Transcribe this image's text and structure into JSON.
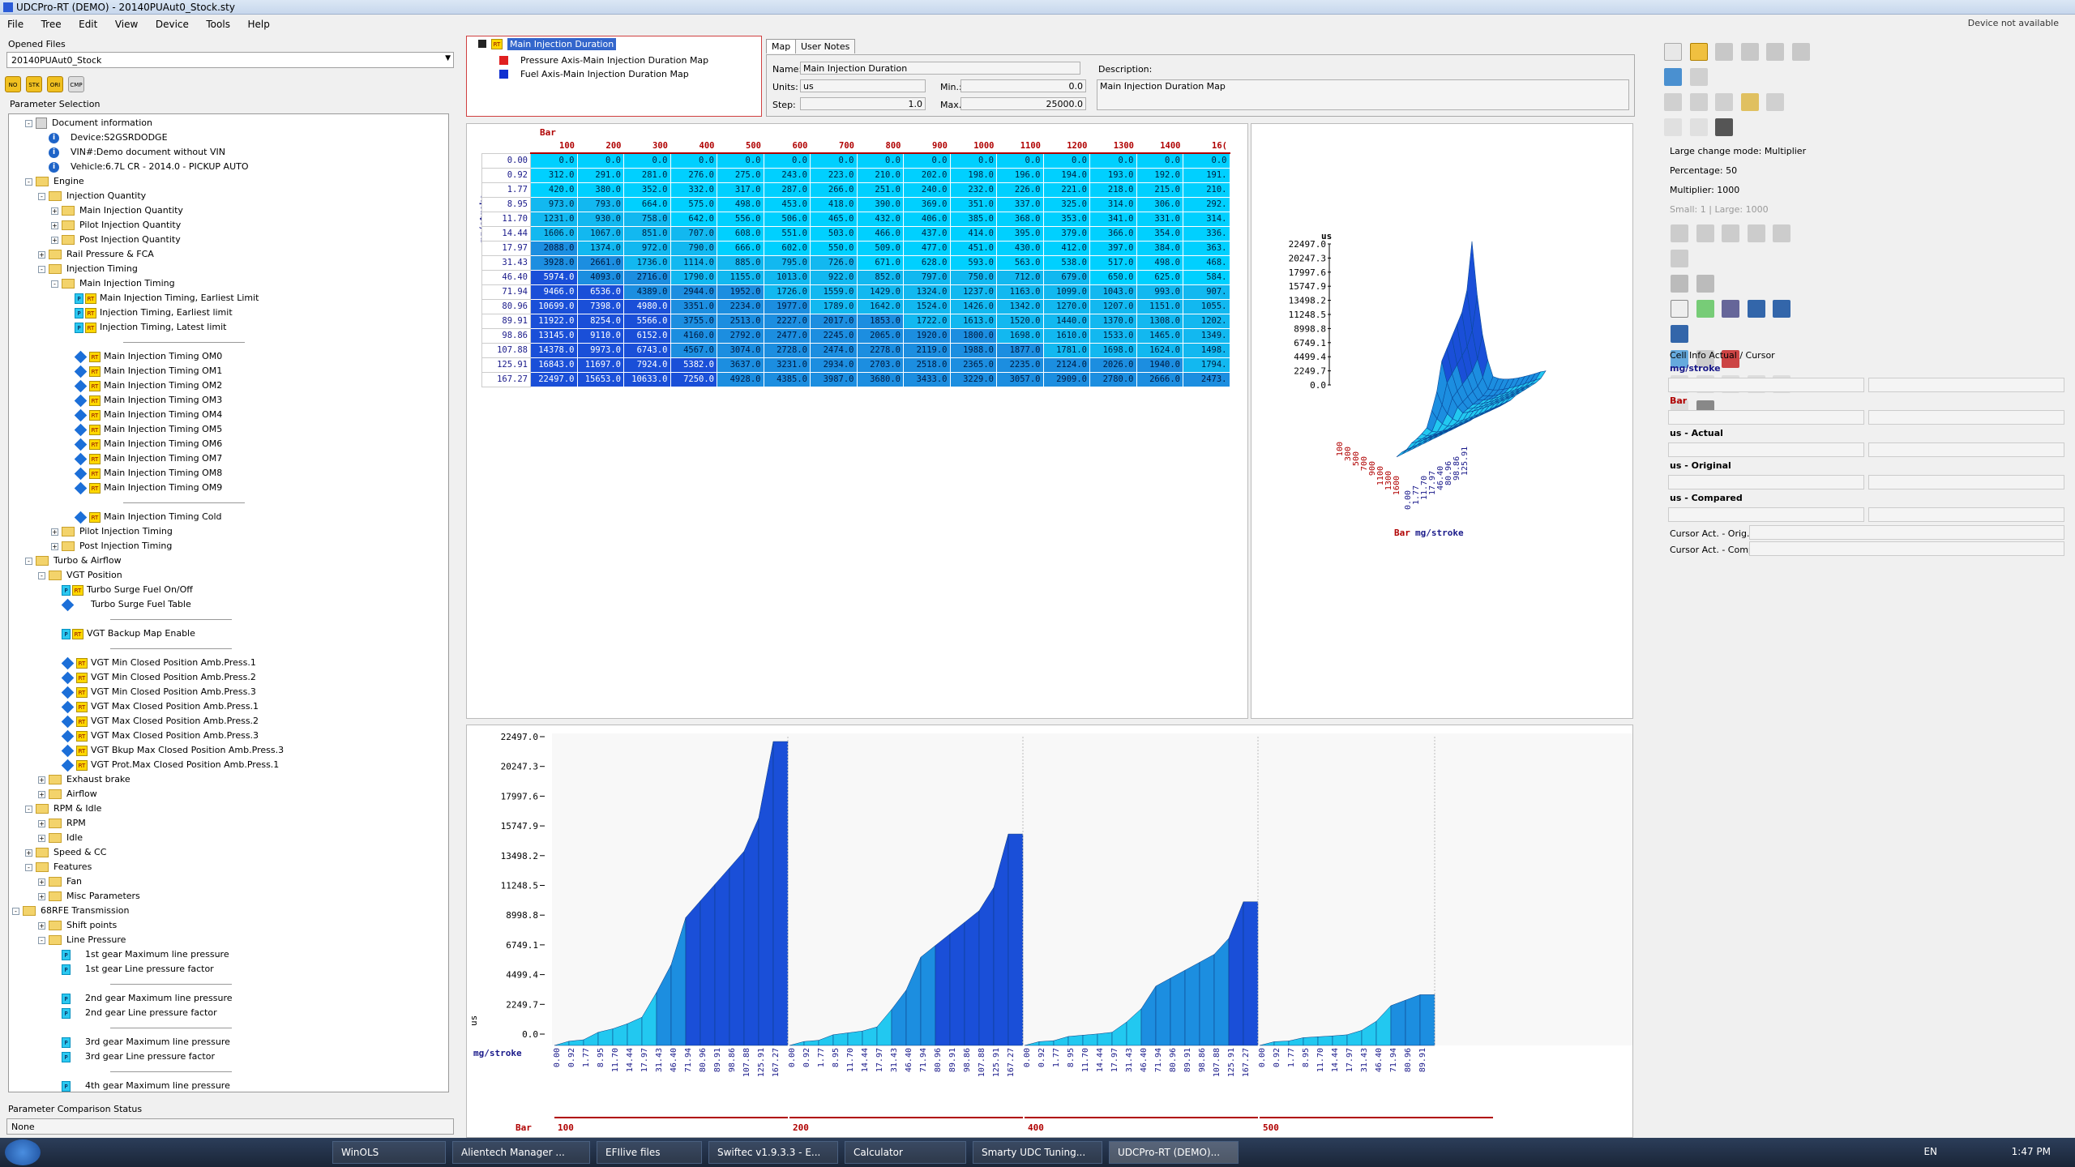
{
  "window": {
    "title": "UDCPro-RT (DEMO) - 20140PUAut0_Stock.sty",
    "device_status": "Device not available"
  },
  "menu": [
    "File",
    "Tree",
    "Edit",
    "View",
    "Device",
    "Tools",
    "Help"
  ],
  "left": {
    "opened_files_label": "Opened Files",
    "opened_file": "20140PUAut0_Stock",
    "toolbar_buttons": [
      "NO",
      "STK",
      "ORI",
      "CMP"
    ],
    "parameter_selection_label": "Parameter Selection",
    "comparison_label": "Parameter Comparison Status",
    "comparison_value": "None"
  },
  "tree": [
    {
      "d": 0,
      "icon": "doc",
      "tog": "-",
      "text": "Document information"
    },
    {
      "d": 1,
      "icon": "info",
      "text": "Device:S2GSRDODGE"
    },
    {
      "d": 1,
      "icon": "info",
      "text": "VIN#:Demo document without VIN"
    },
    {
      "d": 1,
      "icon": "info",
      "text": "Vehicle:6.7L CR - 2014.0 - PICKUP AUTO"
    },
    {
      "d": 0,
      "icon": "folder",
      "tog": "-",
      "text": "Engine"
    },
    {
      "d": 1,
      "icon": "folder",
      "tog": "-",
      "text": "Injection Quantity"
    },
    {
      "d": 2,
      "icon": "folder",
      "tog": "+",
      "text": "Main Injection Quantity"
    },
    {
      "d": 2,
      "icon": "folder",
      "tog": "+",
      "text": "Pilot Injection Quantity"
    },
    {
      "d": 2,
      "icon": "folder",
      "tog": "+",
      "text": "Post Injection Quantity"
    },
    {
      "d": 1,
      "icon": "folder",
      "tog": "+",
      "text": "Rail Pressure & FCA"
    },
    {
      "d": 1,
      "icon": "folder",
      "tog": "-",
      "text": "Injection Timing"
    },
    {
      "d": 2,
      "icon": "folder",
      "tog": "-",
      "text": "Main Injection Timing"
    },
    {
      "d": 3,
      "icon": "prt",
      "text": "Main Injection Timing, Earliest Limit"
    },
    {
      "d": 3,
      "icon": "prt",
      "text": "Injection Timing, Earliest limit"
    },
    {
      "d": 3,
      "icon": "prt",
      "text": "Injection Timing, Latest limit"
    },
    {
      "d": 3,
      "icon": "sep",
      "text": ""
    },
    {
      "d": 3,
      "icon": "drt",
      "text": "Main Injection Timing OM0"
    },
    {
      "d": 3,
      "icon": "drt",
      "text": "Main Injection Timing OM1"
    },
    {
      "d": 3,
      "icon": "drt",
      "text": "Main Injection Timing OM2"
    },
    {
      "d": 3,
      "icon": "drt",
      "text": "Main Injection Timing OM3"
    },
    {
      "d": 3,
      "icon": "drt",
      "text": "Main Injection Timing OM4"
    },
    {
      "d": 3,
      "icon": "drt",
      "text": "Main Injection Timing OM5"
    },
    {
      "d": 3,
      "icon": "drt",
      "text": "Main Injection Timing OM6"
    },
    {
      "d": 3,
      "icon": "drt",
      "text": "Main Injection Timing OM7"
    },
    {
      "d": 3,
      "icon": "drt",
      "text": "Main Injection Timing OM8"
    },
    {
      "d": 3,
      "icon": "drt",
      "text": "Main Injection Timing OM9"
    },
    {
      "d": 3,
      "icon": "sep",
      "text": ""
    },
    {
      "d": 3,
      "icon": "drt",
      "text": "Main Injection Timing Cold"
    },
    {
      "d": 2,
      "icon": "folder",
      "tog": "+",
      "text": "Pilot Injection Timing"
    },
    {
      "d": 2,
      "icon": "folder",
      "tog": "+",
      "text": "Post Injection Timing"
    },
    {
      "d": 0,
      "icon": "folder",
      "tog": "-",
      "text": "Turbo & Airflow",
      "indent": 1
    },
    {
      "d": 1,
      "icon": "folder",
      "tog": "-",
      "text": "VGT Position"
    },
    {
      "d": 2,
      "icon": "prt",
      "text": "Turbo Surge Fuel On/Off"
    },
    {
      "d": 2,
      "icon": "d",
      "text": "Turbo Surge Fuel Table"
    },
    {
      "d": 2,
      "icon": "sep",
      "text": ""
    },
    {
      "d": 2,
      "icon": "prt",
      "text": "VGT Backup Map Enable"
    },
    {
      "d": 2,
      "icon": "sep",
      "text": ""
    },
    {
      "d": 2,
      "icon": "drt",
      "text": "VGT Min Closed Position Amb.Press.1"
    },
    {
      "d": 2,
      "icon": "drt",
      "text": "VGT Min Closed Position Amb.Press.2"
    },
    {
      "d": 2,
      "icon": "drt",
      "text": "VGT Min Closed Position Amb.Press.3"
    },
    {
      "d": 2,
      "icon": "drt",
      "text": "VGT Max Closed Position Amb.Press.1"
    },
    {
      "d": 2,
      "icon": "drt",
      "text": "VGT Max Closed Position Amb.Press.2"
    },
    {
      "d": 2,
      "icon": "drt",
      "text": "VGT Max Closed Position Amb.Press.3"
    },
    {
      "d": 2,
      "icon": "drt",
      "text": "VGT Bkup Max Closed Position Amb.Press.3"
    },
    {
      "d": 2,
      "icon": "drt",
      "text": "VGT Prot.Max Closed Position Amb.Press.1"
    },
    {
      "d": 1,
      "icon": "folder",
      "tog": "+",
      "text": "Exhaust brake"
    },
    {
      "d": 1,
      "icon": "folder",
      "tog": "+",
      "text": "Airflow"
    },
    {
      "d": 0,
      "icon": "folder",
      "tog": "-",
      "text": "RPM & Idle",
      "indent": 1
    },
    {
      "d": 1,
      "icon": "folder",
      "tog": "+",
      "text": "RPM"
    },
    {
      "d": 1,
      "icon": "folder",
      "tog": "+",
      "text": "Idle"
    },
    {
      "d": 0,
      "icon": "folder",
      "tog": "+",
      "text": "Speed & CC",
      "indent": 1
    },
    {
      "d": 0,
      "icon": "folder",
      "tog": "-",
      "text": "Features",
      "indent": 1
    },
    {
      "d": 1,
      "icon": "folder",
      "tog": "+",
      "text": "Fan"
    },
    {
      "d": 1,
      "icon": "folder",
      "tog": "+",
      "text": "Misc Parameters"
    },
    {
      "d": 0,
      "icon": "folder",
      "tog": "-",
      "text": "68RFE Transmission",
      "root": 1
    },
    {
      "d": 1,
      "icon": "folder",
      "tog": "+",
      "text": "Shift points"
    },
    {
      "d": 1,
      "icon": "folder",
      "tog": "-",
      "text": "Line Pressure"
    },
    {
      "d": 2,
      "icon": "p",
      "text": "1st gear Maximum line pressure"
    },
    {
      "d": 2,
      "icon": "p",
      "text": "1st gear Line pressure factor"
    },
    {
      "d": 2,
      "icon": "sep",
      "text": ""
    },
    {
      "d": 2,
      "icon": "p",
      "text": "2nd gear Maximum line pressure"
    },
    {
      "d": 2,
      "icon": "p",
      "text": "2nd gear Line pressure factor"
    },
    {
      "d": 2,
      "icon": "sep",
      "text": ""
    },
    {
      "d": 2,
      "icon": "p",
      "text": "3rd gear Maximum line pressure"
    },
    {
      "d": 2,
      "icon": "p",
      "text": "3rd gear Line pressure factor"
    },
    {
      "d": 2,
      "icon": "sep",
      "text": ""
    },
    {
      "d": 2,
      "icon": "p",
      "text": "4th gear Maximum line pressure"
    }
  ],
  "maplist": {
    "selected": "Main Injection Duration",
    "items": [
      "Pressure Axis-Main Injection Duration Map",
      "Fuel Axis-Main Injection Duration Map"
    ],
    "colors": [
      "#e02020",
      "#1030d0"
    ]
  },
  "props": {
    "tab_map": "Map",
    "tab_notes": "User Notes",
    "name_label": "Name:",
    "name": "Main Injection Duration",
    "units_label": "Units:",
    "units": "us",
    "step_label": "Step:",
    "step": "1.0",
    "min_label": "Min.:",
    "min": "0.0",
    "max_label": "Max.:",
    "max": "25000.0",
    "desc_label": "Description:",
    "desc": "Main Injection Duration Map"
  },
  "table": {
    "col_axis_label": "Bar",
    "row_axis_label": "mg/stroke",
    "cols": [
      "100",
      "200",
      "300",
      "400",
      "500",
      "600",
      "700",
      "800",
      "900",
      "1000",
      "1100",
      "1200",
      "1300",
      "1400",
      "16("
    ],
    "rows": [
      "0.00",
      "0.92",
      "1.77",
      "8.95",
      "11.70",
      "14.44",
      "17.97",
      "31.43",
      "46.40",
      "71.94",
      "80.96",
      "89.91",
      "98.86",
      "107.88",
      "125.91",
      "167.27"
    ],
    "cells": [
      [
        "0.0",
        "0.0",
        "0.0",
        "0.0",
        "0.0",
        "0.0",
        "0.0",
        "0.0",
        "0.0",
        "0.0",
        "0.0",
        "0.0",
        "0.0",
        "0.0",
        "0.0"
      ],
      [
        "312.0",
        "291.0",
        "281.0",
        "276.0",
        "275.0",
        "243.0",
        "223.0",
        "210.0",
        "202.0",
        "198.0",
        "196.0",
        "194.0",
        "193.0",
        "192.0",
        "191."
      ],
      [
        "420.0",
        "380.0",
        "352.0",
        "332.0",
        "317.0",
        "287.0",
        "266.0",
        "251.0",
        "240.0",
        "232.0",
        "226.0",
        "221.0",
        "218.0",
        "215.0",
        "210."
      ],
      [
        "973.0",
        "793.0",
        "664.0",
        "575.0",
        "498.0",
        "453.0",
        "418.0",
        "390.0",
        "369.0",
        "351.0",
        "337.0",
        "325.0",
        "314.0",
        "306.0",
        "292."
      ],
      [
        "1231.0",
        "930.0",
        "758.0",
        "642.0",
        "556.0",
        "506.0",
        "465.0",
        "432.0",
        "406.0",
        "385.0",
        "368.0",
        "353.0",
        "341.0",
        "331.0",
        "314."
      ],
      [
        "1606.0",
        "1067.0",
        "851.0",
        "707.0",
        "608.0",
        "551.0",
        "503.0",
        "466.0",
        "437.0",
        "414.0",
        "395.0",
        "379.0",
        "366.0",
        "354.0",
        "336."
      ],
      [
        "2088.0",
        "1374.0",
        "972.0",
        "790.0",
        "666.0",
        "602.0",
        "550.0",
        "509.0",
        "477.0",
        "451.0",
        "430.0",
        "412.0",
        "397.0",
        "384.0",
        "363."
      ],
      [
        "3928.0",
        "2661.0",
        "1736.0",
        "1114.0",
        "885.0",
        "795.0",
        "726.0",
        "671.0",
        "628.0",
        "593.0",
        "563.0",
        "538.0",
        "517.0",
        "498.0",
        "468."
      ],
      [
        "5974.0",
        "4093.0",
        "2716.0",
        "1790.0",
        "1155.0",
        "1013.0",
        "922.0",
        "852.0",
        "797.0",
        "750.0",
        "712.0",
        "679.0",
        "650.0",
        "625.0",
        "584."
      ],
      [
        "9466.0",
        "6536.0",
        "4389.0",
        "2944.0",
        "1952.0",
        "1726.0",
        "1559.0",
        "1429.0",
        "1324.0",
        "1237.0",
        "1163.0",
        "1099.0",
        "1043.0",
        "993.0",
        "907."
      ],
      [
        "10699.0",
        "7398.0",
        "4980.0",
        "3351.0",
        "2234.0",
        "1977.0",
        "1789.0",
        "1642.0",
        "1524.0",
        "1426.0",
        "1342.0",
        "1270.0",
        "1207.0",
        "1151.0",
        "1055."
      ],
      [
        "11922.0",
        "8254.0",
        "5566.0",
        "3755.0",
        "2513.0",
        "2227.0",
        "2017.0",
        "1853.0",
        "1722.0",
        "1613.0",
        "1520.0",
        "1440.0",
        "1370.0",
        "1308.0",
        "1202."
      ],
      [
        "13145.0",
        "9110.0",
        "6152.0",
        "4160.0",
        "2792.0",
        "2477.0",
        "2245.0",
        "2065.0",
        "1920.0",
        "1800.0",
        "1698.0",
        "1610.0",
        "1533.0",
        "1465.0",
        "1349."
      ],
      [
        "14378.0",
        "9973.0",
        "6743.0",
        "4567.0",
        "3074.0",
        "2728.0",
        "2474.0",
        "2278.0",
        "2119.0",
        "1988.0",
        "1877.0",
        "1781.0",
        "1698.0",
        "1624.0",
        "1498."
      ],
      [
        "16843.0",
        "11697.0",
        "7924.0",
        "5382.0",
        "3637.0",
        "3231.0",
        "2934.0",
        "2703.0",
        "2518.0",
        "2365.0",
        "2235.0",
        "2124.0",
        "2026.0",
        "1940.0",
        "1794."
      ],
      [
        "22497.0",
        "15653.0",
        "10633.0",
        "7250.0",
        "4928.0",
        "4385.0",
        "3987.0",
        "3680.0",
        "3433.0",
        "3229.0",
        "3057.0",
        "2909.0",
        "2780.0",
        "2666.0",
        "2473."
      ]
    ]
  },
  "chart_data": [
    {
      "type": "surface",
      "zlabel": "us",
      "xlabel": "Bar",
      "ylabel": "mg/stroke",
      "zticks": [
        "22497.0",
        "20247.3",
        "17997.6",
        "15747.9",
        "13498.2",
        "11248.5",
        "8998.8",
        "6749.1",
        "4499.4",
        "2249.7",
        "0.0"
      ],
      "xticks": [
        "100",
        "300",
        "500",
        "700",
        "900",
        "1100",
        "1300",
        "1600"
      ],
      "yticks": [
        "0.00",
        "1.77",
        "11.70",
        "17.97",
        "46.40",
        "80.96",
        "98.86",
        "125.91"
      ],
      "zlim": [
        0,
        22497
      ]
    },
    {
      "type": "area",
      "ylabel": "us",
      "xlabel_rows": "mg/stroke",
      "xlabel_groups": "Bar",
      "ylim": [
        0,
        22497
      ],
      "yticks": [
        "22497.0",
        "20247.3",
        "17997.6",
        "15747.9",
        "13498.2",
        "11248.5",
        "8998.8",
        "6749.1",
        "4499.4",
        "2249.7",
        "0.0"
      ],
      "groups": [
        "100",
        "200",
        "400",
        "500"
      ],
      "group_series_cols": [
        0,
        1,
        2,
        3
      ],
      "visible_rows_last_group": 12
    }
  ],
  "right": {
    "change_mode": "Large change mode: Multiplier",
    "percentage": "Percentage: 50",
    "multiplier": "Multiplier: 1000",
    "small_large": "Small: 1 | Large: 1000",
    "cell_info": "Cell Info Actual / Cursor",
    "f_mgstroke": "mg/stroke",
    "f_bar": "Bar",
    "f_actual": "us - Actual",
    "f_original": "us - Original",
    "f_compared": "us - Compared",
    "cursor_orig": "Cursor Act. - Orig.",
    "cursor_comp": "Cursor Act. - Comp."
  },
  "taskbar": {
    "tasks": [
      "WinOLS",
      "Alientech Manager ...",
      "EFIlive files",
      "Swiftec v1.9.3.3 - E...",
      "Calculator",
      "Smarty UDC Tuning...",
      "UDCPro-RT (DEMO)..."
    ],
    "lang": "EN",
    "clock": "1:47 PM"
  }
}
